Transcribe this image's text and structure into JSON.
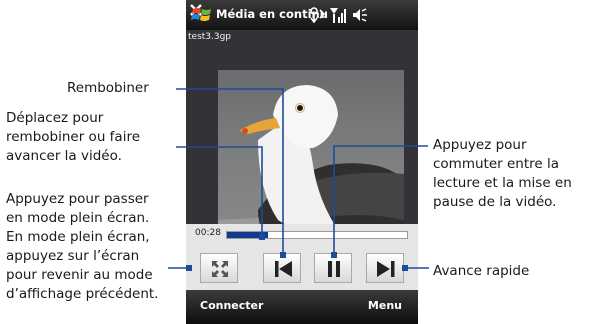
{
  "window": {
    "title": "Média en continu",
    "filename": "test3.3gp"
  },
  "player": {
    "time": "00:28",
    "progress": 0.23,
    "controls": [
      "full-screen",
      "rewind",
      "pause",
      "fast-forward"
    ]
  },
  "softkeys": {
    "left": "Connecter",
    "right": "Menu"
  },
  "annotations": {
    "rewind": "Rembobiner",
    "seek": "Déplacez pour\nrembobiner ou faire\navancer la vidéo.",
    "fullscreen": "Appuyez pour passer\nen mode plein écran.\nEn mode plein écran,\nappuyez sur l’écran\npour revenir au mode\nd’affichage précédent.",
    "pause": "Appuyez pour\ncommuter entre la\nlecture et la mise en\npause de la vidéo.",
    "fastforward": "Avance rapide"
  },
  "colors": {
    "callout_line": "#1e4b9a",
    "progress_fill": "#123a8e",
    "title_bar": "#1e1e1e",
    "control_bg": "#e5e5e5"
  },
  "icons": [
    "windows-logo-icon",
    "sync-icon",
    "signal-icon",
    "volume-icon",
    "close-icon",
    "fullscreen-icon",
    "rewind-icon",
    "pause-icon",
    "fast-forward-icon"
  ]
}
